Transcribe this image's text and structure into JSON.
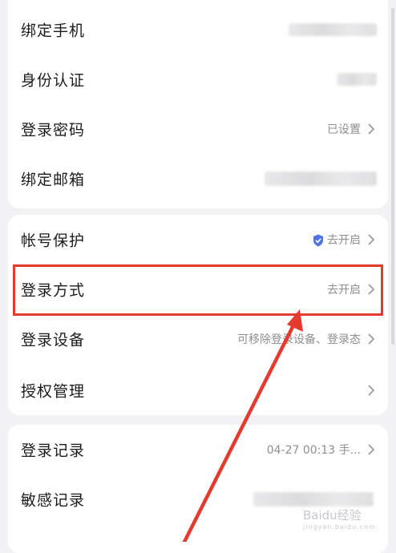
{
  "section1": {
    "rows": [
      {
        "label": "绑定手机",
        "value": ""
      },
      {
        "label": "身份认证",
        "value": ""
      },
      {
        "label": "登录密码",
        "value": "已设置"
      },
      {
        "label": "绑定邮箱",
        "value": ""
      }
    ]
  },
  "section2": {
    "rows": [
      {
        "label": "帐号保护",
        "value": "去开启"
      },
      {
        "label": "登录方式",
        "value": "去开启"
      },
      {
        "label": "登录设备",
        "value": "可移除登录设备、登录态"
      },
      {
        "label": "授权管理",
        "value": ""
      }
    ]
  },
  "section3": {
    "rows": [
      {
        "label": "登录记录",
        "value": "04-27 00:13 手..."
      },
      {
        "label": "敏感记录",
        "value": ""
      }
    ]
  },
  "watermark": {
    "brand": "Baidu经验",
    "url": "jingyan.baidu.com"
  },
  "colors": {
    "highlight": "#e53a2e",
    "shield": "#4f74e8"
  },
  "icons": [
    "chevron-right-icon",
    "shield-check-icon",
    "arrow-annotation"
  ]
}
